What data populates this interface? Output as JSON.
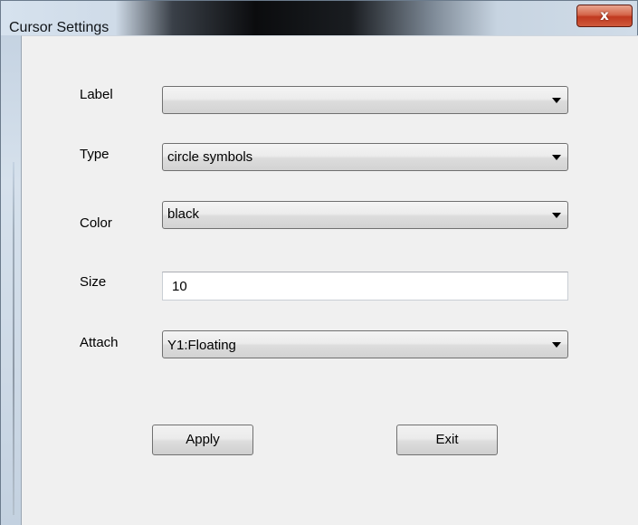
{
  "window": {
    "title": "Cursor Settings",
    "close_label": "x"
  },
  "fields": {
    "label": {
      "label": "Label",
      "value": ""
    },
    "type": {
      "label": "Type",
      "value": "circle symbols"
    },
    "color": {
      "label": "Color",
      "value": "black"
    },
    "size": {
      "label": "Size",
      "value": "10"
    },
    "attach": {
      "label": "Attach",
      "value": "Y1:Floating"
    }
  },
  "buttons": {
    "apply": "Apply",
    "exit": "Exit"
  },
  "icons": {
    "close": "close-icon",
    "dropdown": "chevron-down-icon"
  }
}
